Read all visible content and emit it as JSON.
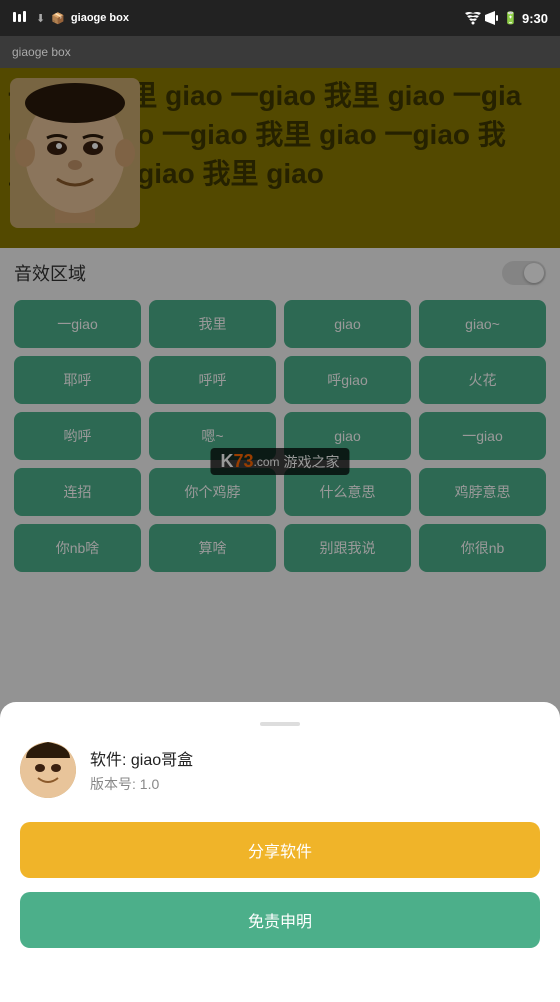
{
  "statusBar": {
    "time": "9:30",
    "appLabel": "giaoge box"
  },
  "banner": {
    "bgWords": [
      "一giao",
      "我里",
      "giao",
      "一giao",
      "我里",
      "giao",
      "一giao",
      "我里",
      "giao",
      "一giao",
      "我里",
      "giao"
    ]
  },
  "soundSection": {
    "title": "音效区域",
    "buttons": [
      "一giao",
      "我里",
      "giao",
      "giao~",
      "耶呼",
      "呼呼",
      "呼giao",
      "火花",
      "哟呼",
      "嗯~",
      "giao",
      "一giao",
      "连招",
      "你个鸡脖",
      "什么意思",
      "鸡脖意思",
      "你nb啥",
      "算啥",
      "别跟我说",
      "你很nb"
    ]
  },
  "modal": {
    "handle": "",
    "appIcon": "face-avatar",
    "appName": "软件: giao哥盒",
    "appVersion": "版本号: 1.0",
    "shareLabel": "分享软件",
    "disclaimerLabel": "免责申明"
  },
  "watermark": {
    "main": "K73",
    "sub": "游戏之家",
    "domain": ".com"
  },
  "colors": {
    "green": "#4CAF8A",
    "yellow": "#f0b429",
    "banner": "#8b7a00"
  }
}
